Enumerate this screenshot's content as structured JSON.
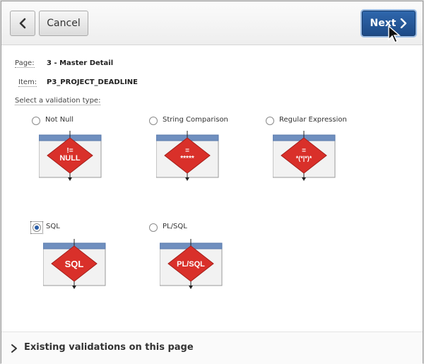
{
  "toolbar": {
    "back_icon": "chevron-left-icon",
    "cancel_label": "Cancel",
    "next_label": "Next",
    "next_icon": "chevron-right-icon"
  },
  "info": {
    "page_label": "Page:",
    "page_value": "3 - Master Detail",
    "item_label": "Item:",
    "item_value": "P3_PROJECT_DEADLINE",
    "prompt": "Select a validation type:"
  },
  "options": [
    {
      "label": "Not Null",
      "symbol_top": "!=",
      "symbol_bottom": "NULL",
      "checked": false
    },
    {
      "label": "String Comparison",
      "symbol_top": "=",
      "symbol_bottom": "*****",
      "checked": false
    },
    {
      "label": "Regular Expression",
      "symbol_top": "=",
      "symbol_bottom": "*(*|*)*",
      "checked": false
    },
    {
      "label": "SQL",
      "symbol_top": "",
      "symbol_bottom": "SQL",
      "checked": true
    },
    {
      "label": "PL/SQL",
      "symbol_top": "",
      "symbol_bottom": "PL/SQL",
      "checked": false
    }
  ],
  "footer": {
    "label": "Existing validations on this page",
    "icon": "chevron-right-icon"
  },
  "colors": {
    "next_button": "#2a5ea8",
    "diamond": "#d9302a",
    "card_header": "#6f8fbf"
  }
}
